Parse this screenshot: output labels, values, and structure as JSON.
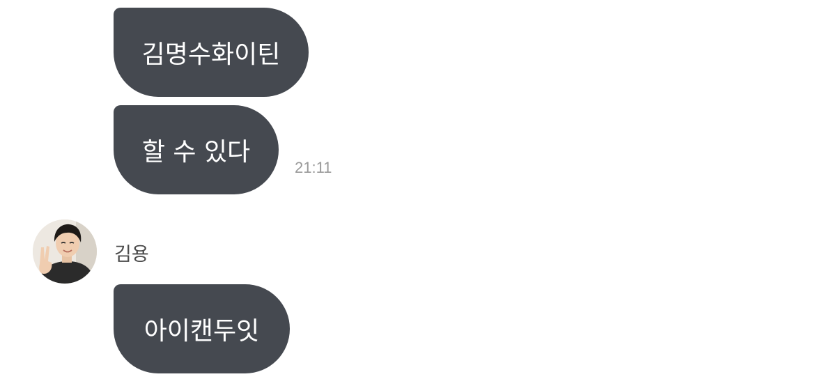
{
  "messages_sent": [
    {
      "text": "김명수화이틴"
    },
    {
      "text": "할 수 있다"
    }
  ],
  "sent_time": "21:11",
  "received": {
    "sender_name": "김용",
    "avatar_icon": "user-profile-photo",
    "messages": [
      {
        "text": "아이캔두잇"
      }
    ]
  },
  "colors": {
    "bubble": "#454950",
    "bubble_text": "#ffffff",
    "timestamp": "#9a9a9a",
    "background": "#ffffff"
  }
}
